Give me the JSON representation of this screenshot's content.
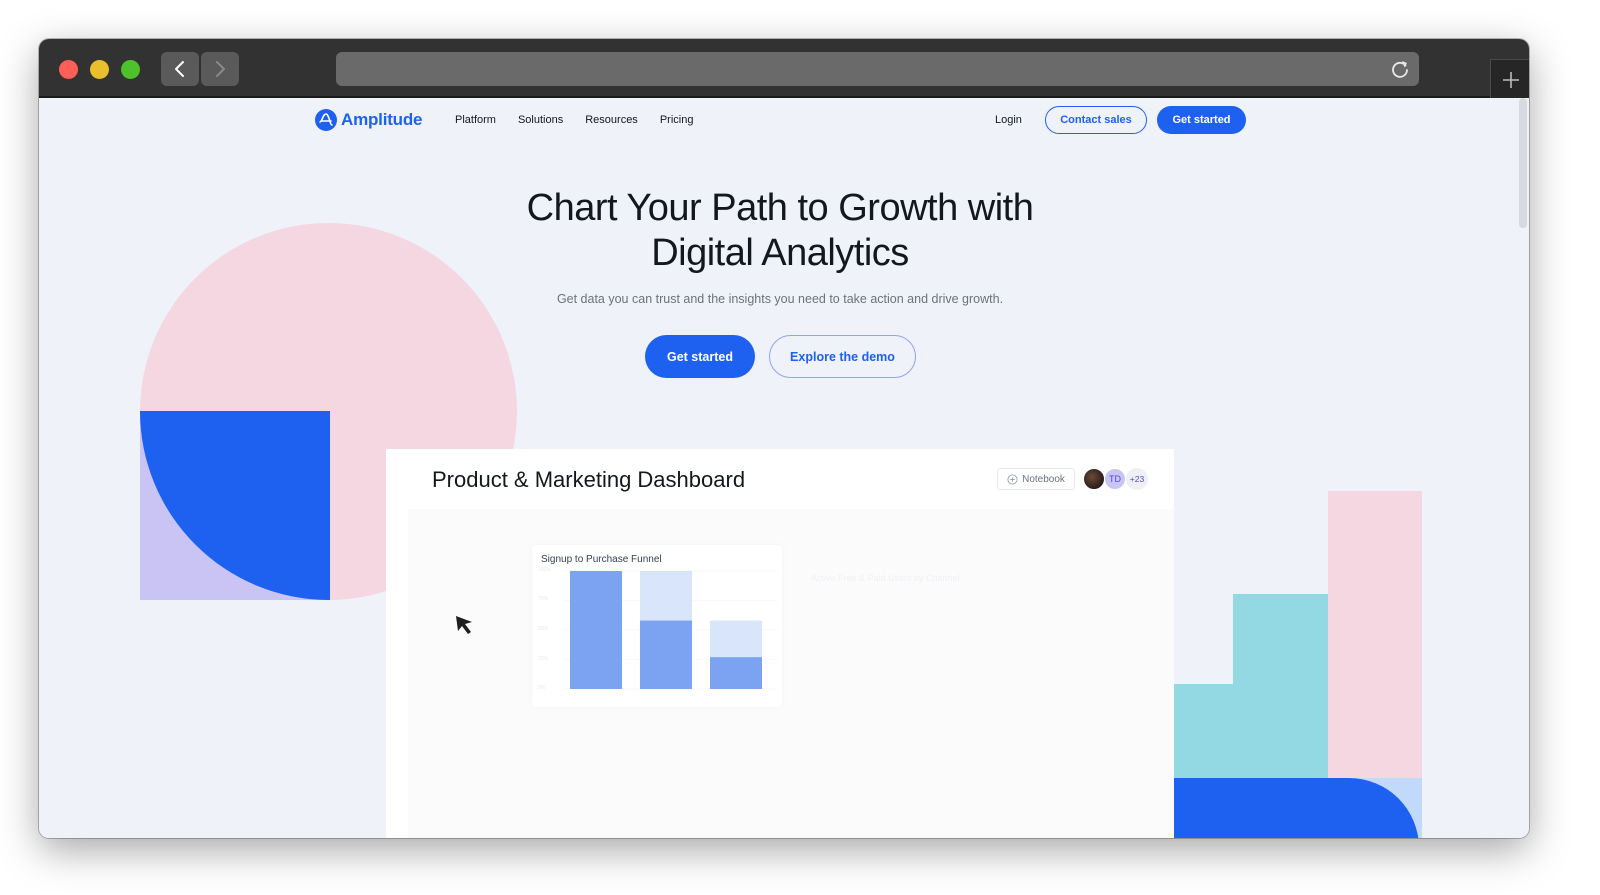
{
  "browser": {
    "back_icon": "chevron-left-icon",
    "forward_icon": "chevron-right-icon",
    "reload_icon": "reload-icon",
    "new_tab_icon": "plus-icon",
    "url": ""
  },
  "nav": {
    "logo_text": "Amplitude",
    "links": [
      "Platform",
      "Solutions",
      "Resources",
      "Pricing"
    ],
    "login": "Login",
    "contact_sales": "Contact sales",
    "get_started": "Get started"
  },
  "hero": {
    "title_line1": "Chart Your Path to Growth with",
    "title_line2": "Digital Analytics",
    "subtitle": "Get data you can trust and the insights you need to take action and drive growth.",
    "primary_cta": "Get started",
    "secondary_cta": "Explore the demo"
  },
  "dashboard": {
    "title": "Product & Marketing Dashboard",
    "notebook_label": "Notebook",
    "avatar_initials": "TD",
    "avatar_more": "+23",
    "ghost_chart_title": "Active Free & Paid Users by Channel",
    "funnel": {
      "title": "Signup to Purchase Funnel",
      "y_ticks": [
        "100%",
        "75%",
        "50%",
        "25%",
        "0%"
      ],
      "steps": [
        {
          "converted": 100,
          "previous": 100
        },
        {
          "converted": 58,
          "previous": 100
        },
        {
          "converted": 27,
          "previous": 58
        }
      ],
      "colors": {
        "converted": "#7ba3f2",
        "dropoff": "#d9e5fb"
      }
    }
  }
}
